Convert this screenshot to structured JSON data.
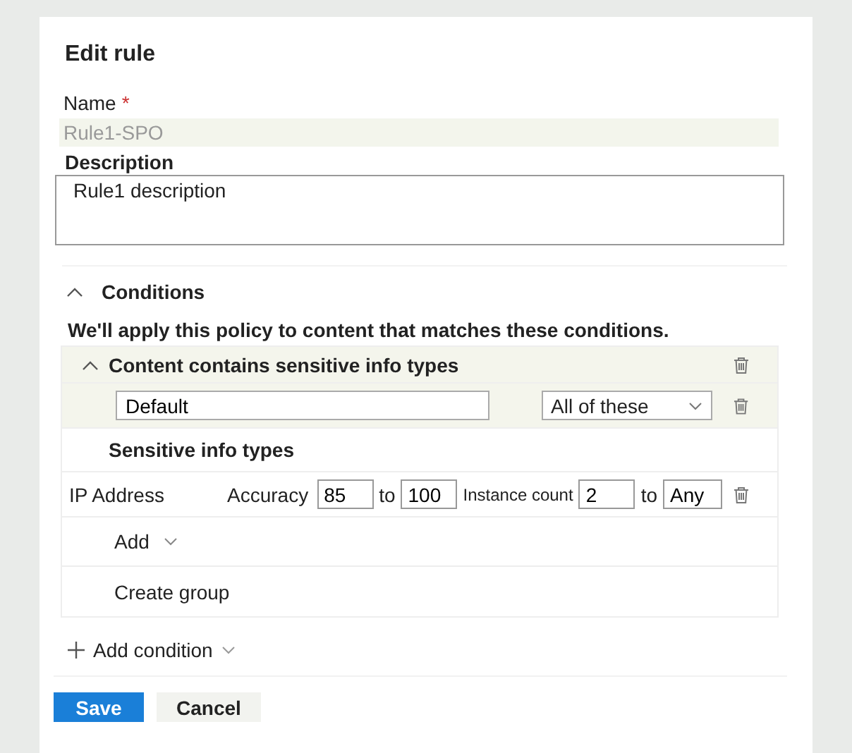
{
  "title": "Edit rule",
  "name_field": {
    "label": "Name",
    "required_mark": "*",
    "value": "Rule1-SPO",
    "disabled": true
  },
  "description_field": {
    "label": "Description",
    "value": "Rule1 description"
  },
  "conditions": {
    "label": "Conditions",
    "expanded": true,
    "intro": "We'll apply this policy to content that matches these conditions.",
    "group": {
      "title": "Content contains sensitive info types",
      "expanded": true,
      "group_name": "Default",
      "match": "All of these",
      "section_label": "Sensitive info types",
      "types": [
        {
          "name": "IP Address",
          "accuracy_label": "Accuracy",
          "accuracy_min": "85",
          "accuracy_to": "to",
          "accuracy_max": "100",
          "count_label": "Instance count",
          "count_min": "2",
          "count_to": "to",
          "count_max": "Any"
        }
      ],
      "add_label": "Add",
      "create_group_label": "Create group"
    },
    "add_condition": "Add condition"
  },
  "buttons": [
    {
      "label": "Save",
      "kind": "primary"
    },
    {
      "label": "Cancel",
      "kind": "secondary"
    }
  ]
}
